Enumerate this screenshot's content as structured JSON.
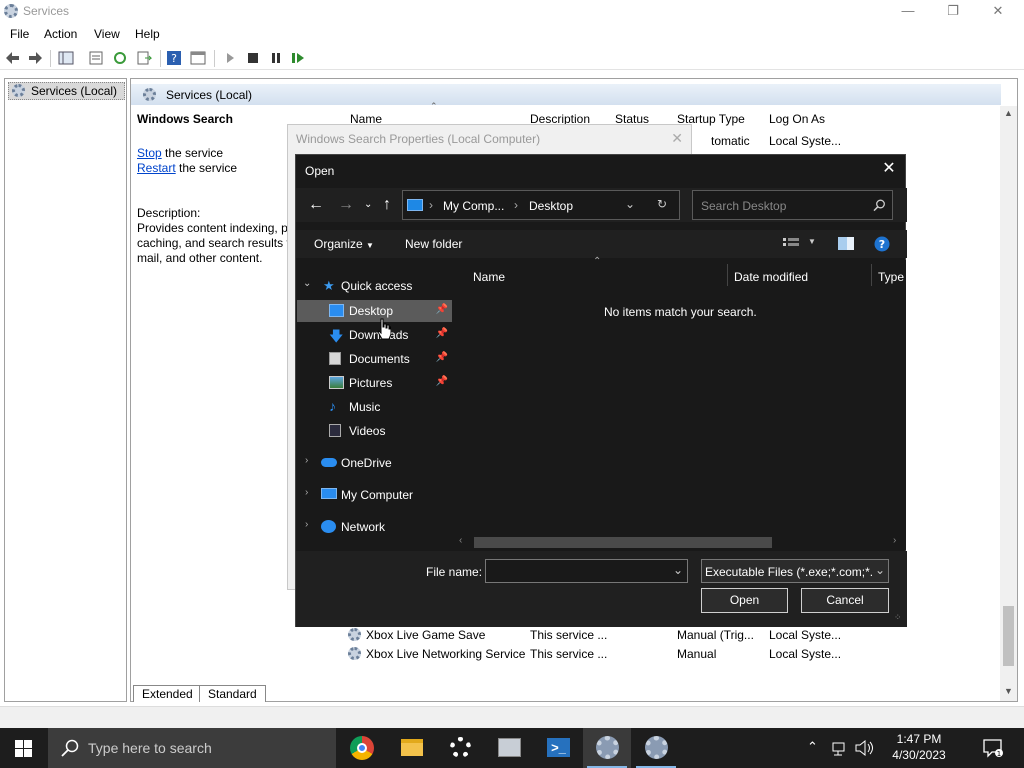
{
  "services_window": {
    "title": "Services",
    "menu": [
      "File",
      "Action",
      "View",
      "Help"
    ],
    "tree_item": "Services (Local)",
    "detail_header": "Services (Local)",
    "selected_service": "Windows Search",
    "actions": {
      "stop_link": "Stop",
      "stop_suffix": " the service",
      "restart_link": "Restart",
      "restart_suffix": " the service"
    },
    "description_label": "Description:",
    "description_lines": [
      "Provides content indexing, p",
      "caching, and search results fo",
      "mail, and other content."
    ],
    "columns": [
      "Name",
      "Description",
      "Status",
      "Startup Type",
      "Log On As"
    ],
    "visible_row_top": {
      "startup": "tomatic",
      "logon": "Local Syste..."
    },
    "rows": [
      {
        "name": "Xbox Live Game Save",
        "description": "This service ...",
        "status": "",
        "startup": "Manual (Trig...",
        "logon": "Local Syste..."
      },
      {
        "name": "Xbox Live Networking Service",
        "description": "This service ...",
        "status": "",
        "startup": "Manual",
        "logon": "Local Syste..."
      }
    ],
    "tabs": [
      "Extended",
      "Standard"
    ]
  },
  "properties_dialog": {
    "title": "Windows Search Properties (Local Computer)"
  },
  "open_dialog": {
    "title": "Open",
    "address": [
      "My Comp...",
      "Desktop"
    ],
    "search_placeholder": "Search Desktop",
    "organize_label": "Organize",
    "new_folder_label": "New folder",
    "nav": {
      "quick_access": "Quick access",
      "items": [
        {
          "label": "Desktop",
          "icon": "desktop-icon",
          "pinned": true
        },
        {
          "label": "Downloads",
          "icon": "downloads-icon",
          "pinned": true
        },
        {
          "label": "Documents",
          "icon": "documents-icon",
          "pinned": true
        },
        {
          "label": "Pictures",
          "icon": "pictures-icon",
          "pinned": true
        },
        {
          "label": "Music",
          "icon": "music-icon",
          "pinned": false
        },
        {
          "label": "Videos",
          "icon": "videos-icon",
          "pinned": false
        }
      ],
      "onedrive": "OneDrive",
      "my_computer": "My Computer",
      "network": "Network"
    },
    "list_columns": [
      "Name",
      "Date modified",
      "Type"
    ],
    "empty_message": "No items match your search.",
    "file_name_label": "File name:",
    "file_name_value": "",
    "file_type": "Executable Files (*.exe;*.com;*.",
    "open_button": "Open",
    "cancel_button": "Cancel"
  },
  "taskbar": {
    "search_placeholder": "Type here to search",
    "time": "1:47 PM",
    "date": "4/30/2023"
  },
  "colors": {
    "dialog_bg": "#191919",
    "selection": "#5b5b5b",
    "link": "#0044cc",
    "taskbar": "#1d1d1d"
  }
}
